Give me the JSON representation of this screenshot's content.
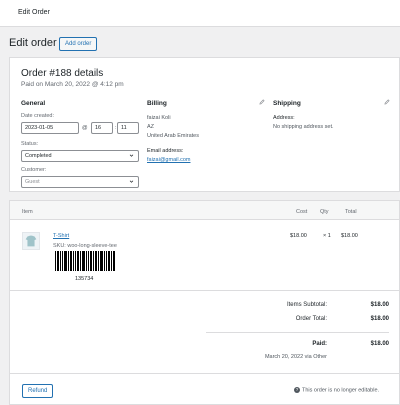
{
  "topbar": {
    "title": "Edit Order"
  },
  "page": {
    "heading": "Edit order",
    "add_button": "Add order"
  },
  "order": {
    "title": "Order #188 details",
    "paid_on": "Paid on March 20, 2022 @ 4:12 pm",
    "general": {
      "heading": "General",
      "date_label": "Date created:",
      "date": "2023-01-05",
      "at": "@",
      "hour": "16",
      "minute": "11",
      "status_label": "Status:",
      "status": "Completed",
      "customer_label": "Customer:",
      "customer": "Guest"
    },
    "billing": {
      "heading": "Billing",
      "name": "faizai Koli",
      "state": "AZ",
      "country": "United Arab Emirates",
      "email_label": "Email address:",
      "email": "faizai@gmail.com"
    },
    "shipping": {
      "heading": "Shipping",
      "address_label": "Address:",
      "address": "No shipping address set."
    }
  },
  "items": {
    "headers": {
      "item": "Item",
      "cost": "Cost",
      "qty": "Qty",
      "total": "Total"
    },
    "rows": [
      {
        "name": "T-Shirt",
        "sku": "SKU: woo-long-sleeve-tee",
        "barcode_number": "135734",
        "cost": "$18.00",
        "qty": "× 1",
        "total": "$18.00"
      }
    ]
  },
  "totals": {
    "subtotal_label": "Items Subtotal:",
    "subtotal": "$18.00",
    "order_total_label": "Order Total:",
    "order_total": "$18.00",
    "paid_label": "Paid:",
    "paid": "$18.00",
    "paid_note": "March 20, 2022 via Other"
  },
  "footer": {
    "refund_button": "Refund",
    "note": "This order is no longer editable.",
    "note_icon": "?"
  },
  "colors": {
    "accent": "#2271b1",
    "background": "#f0f0f1",
    "border": "#dcdcde"
  }
}
